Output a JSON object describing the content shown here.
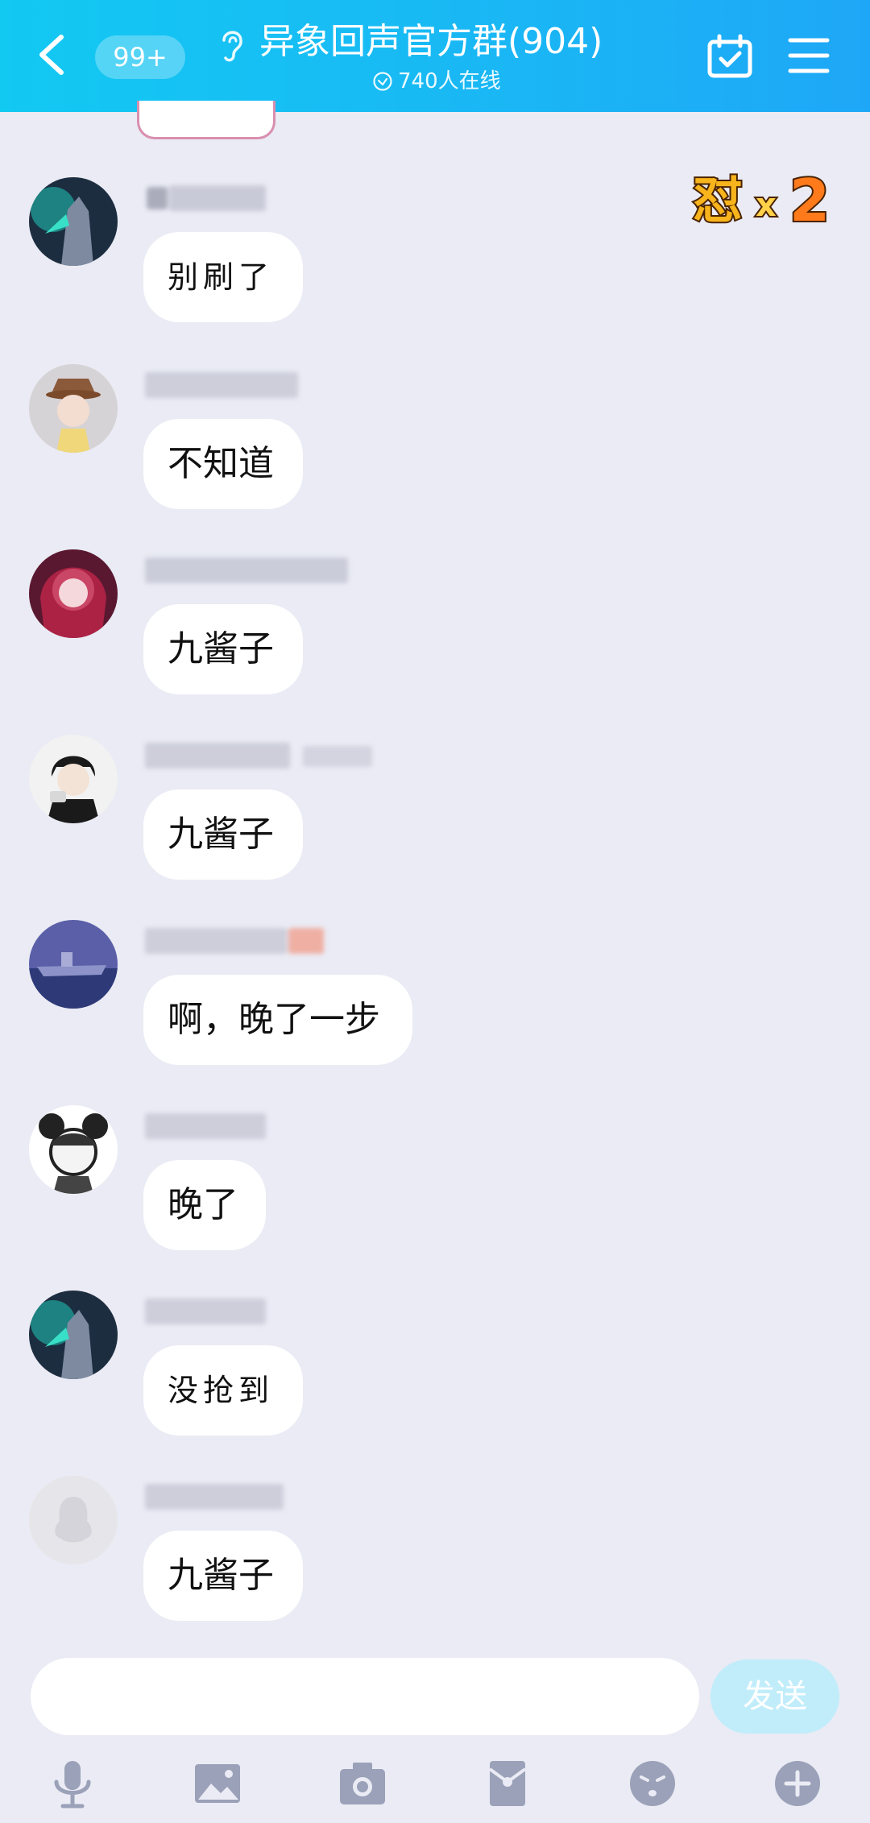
{
  "header": {
    "unread_count": "99+",
    "group_title": "异象回声官方群(904)",
    "online_text": "740人在线"
  },
  "messages": [
    {
      "text": "别刷了",
      "style": "handwriting"
    },
    {
      "text": "不知道",
      "style": "normal"
    },
    {
      "text": "九酱子",
      "style": "normal"
    },
    {
      "text": "九酱子",
      "style": "normal"
    },
    {
      "text": "啊，晚了一步",
      "style": "normal"
    },
    {
      "text": "晚了",
      "style": "normal"
    },
    {
      "text": "没抢到",
      "style": "handwriting"
    },
    {
      "text": "九酱子",
      "style": "normal"
    }
  ],
  "badge": {
    "text": "怼x2"
  },
  "input": {
    "value": "",
    "send_label": "发送"
  },
  "toolbar": {
    "icons": [
      "microphone-icon",
      "image-icon",
      "camera-icon",
      "red-packet-icon",
      "emoji-icon",
      "plus-icon"
    ]
  },
  "colors": {
    "header_gradient_start": "#12c9f2",
    "header_gradient_end": "#1ea7f6",
    "background": "#eaebf4",
    "bubble": "#ffffff",
    "send_button": "#c1edfb",
    "toolbar_icon": "#9aa1b8"
  }
}
